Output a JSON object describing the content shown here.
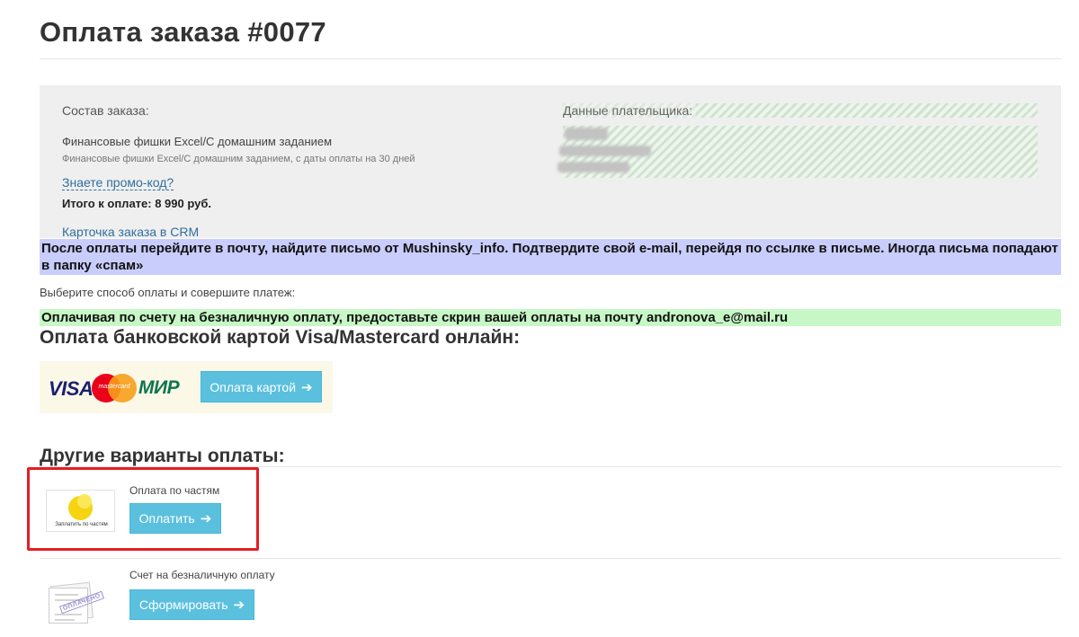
{
  "page": {
    "title": "Оплата заказа #0077"
  },
  "order": {
    "label": "Состав заказа:",
    "item_title": "Финансовые фишки Excel/С домашним заданием",
    "item_subtitle": "Финансовые фишки Excel/С домашним заданием, с даты оплаты на 30 дней",
    "promo_link": "Знаете промо-код?",
    "total": "Итого к оплате: 8 990 руб.",
    "crm_link": "Карточка заказа в CRM"
  },
  "payer": {
    "label": "Данные плательщика:"
  },
  "notices": {
    "mail_notice": "После оплаты перейдите в почту, найдите письмо от Mushinsky_info. Подтвердите свой e-mail, перейдя по ссылке в письме. Иногда письма попадают в папку «спам»",
    "choose_method": "Выберите способ оплаты и совершите платеж:",
    "invoice_notice": "Оплачивая по счету на безналичную оплату, предоставьте скрин вашей оплаты на почту andronova_e@mail.ru"
  },
  "card_payment": {
    "heading": "Оплата банковской картой Visa/Mastercard онлайн:",
    "brand_visa": "VISA",
    "brand_mastercard": "mastercard",
    "brand_mir": "МИР",
    "button_label": "Оплата картой",
    "arrow_icon": "➔"
  },
  "other_payment": {
    "heading": "Другие варианты оплаты:",
    "installments": {
      "logo_caption": "Заплатить по частям",
      "label": "Оплата по частям",
      "button_label": "Оплатить",
      "arrow_icon": "➔"
    },
    "invoice": {
      "stamp_text": "ОПЛАЧЕНО",
      "label": "Счет на безналичную оплату",
      "button_label": "Сформировать",
      "arrow_icon": "➔"
    }
  },
  "colors": {
    "accent_button": "#5bc0de",
    "link": "#2f6e9e",
    "mail_notice_bg": "#c9cdfb",
    "invoice_notice_bg": "#c7f7c6",
    "highlight_border": "#e41e26"
  }
}
